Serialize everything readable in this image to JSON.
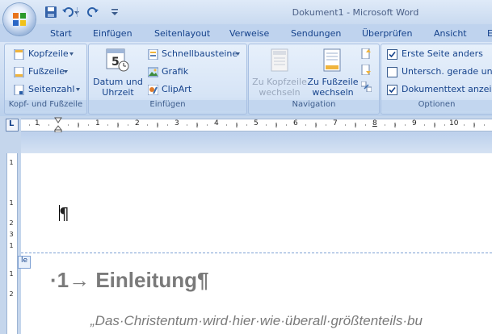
{
  "window": {
    "title": "Dokument1 - Microsoft Word"
  },
  "quick_access": {
    "icons": [
      "save-icon",
      "undo-icon",
      "redo-icon",
      "customize-icon"
    ]
  },
  "tabs": [
    "Start",
    "Einfügen",
    "Seitenlayout",
    "Verweise",
    "Sendungen",
    "Überprüfen",
    "Ansicht",
    "E"
  ],
  "ribbon": {
    "group_header_footer": {
      "label": "Kopf- und Fußzeile",
      "kopfzeile": "Kopfzeile",
      "fusszeile": "Fußzeile",
      "seitenzahl": "Seitenzahl"
    },
    "group_insert": {
      "label": "Einfügen",
      "datum_line1": "Datum und",
      "datum_line2": "Uhrzeit",
      "schnellbausteine": "Schnellbausteine",
      "grafik": "Grafik",
      "clipart": "ClipArt"
    },
    "group_navigation": {
      "label": "Navigation",
      "zu_kopfzeile_line1": "Zu Kopfzeile",
      "zu_kopfzeile_line2": "wechseln",
      "zu_fusszeile_line1": "Zu Fußzeile",
      "zu_fusszeile_line2": "wechseln"
    },
    "group_options": {
      "label": "Optionen",
      "erste_seite": "Erste Seite anders",
      "erste_seite_checked": true,
      "untersch": "Untersch. gerade  ung",
      "untersch_checked": false,
      "dokumenttext": "Dokumenttext anzeig",
      "dokumenttext_checked": true
    }
  },
  "ruler": {
    "tab_selector": "L",
    "numbers": [
      "1",
      "1",
      "2",
      "3",
      "4",
      "5",
      "6",
      "7",
      "8",
      "9",
      "10"
    ]
  },
  "vertical_ruler": {
    "numbers": [
      "1",
      "1",
      "2",
      "3",
      "1",
      "1",
      "2"
    ]
  },
  "document": {
    "header_pilcrow": "¶",
    "header_tag": "le",
    "heading": "·1→ Einleitung¶",
    "quote": "„Das·Christentum·wird·hier·wie·überall·größtenteils·bu"
  }
}
